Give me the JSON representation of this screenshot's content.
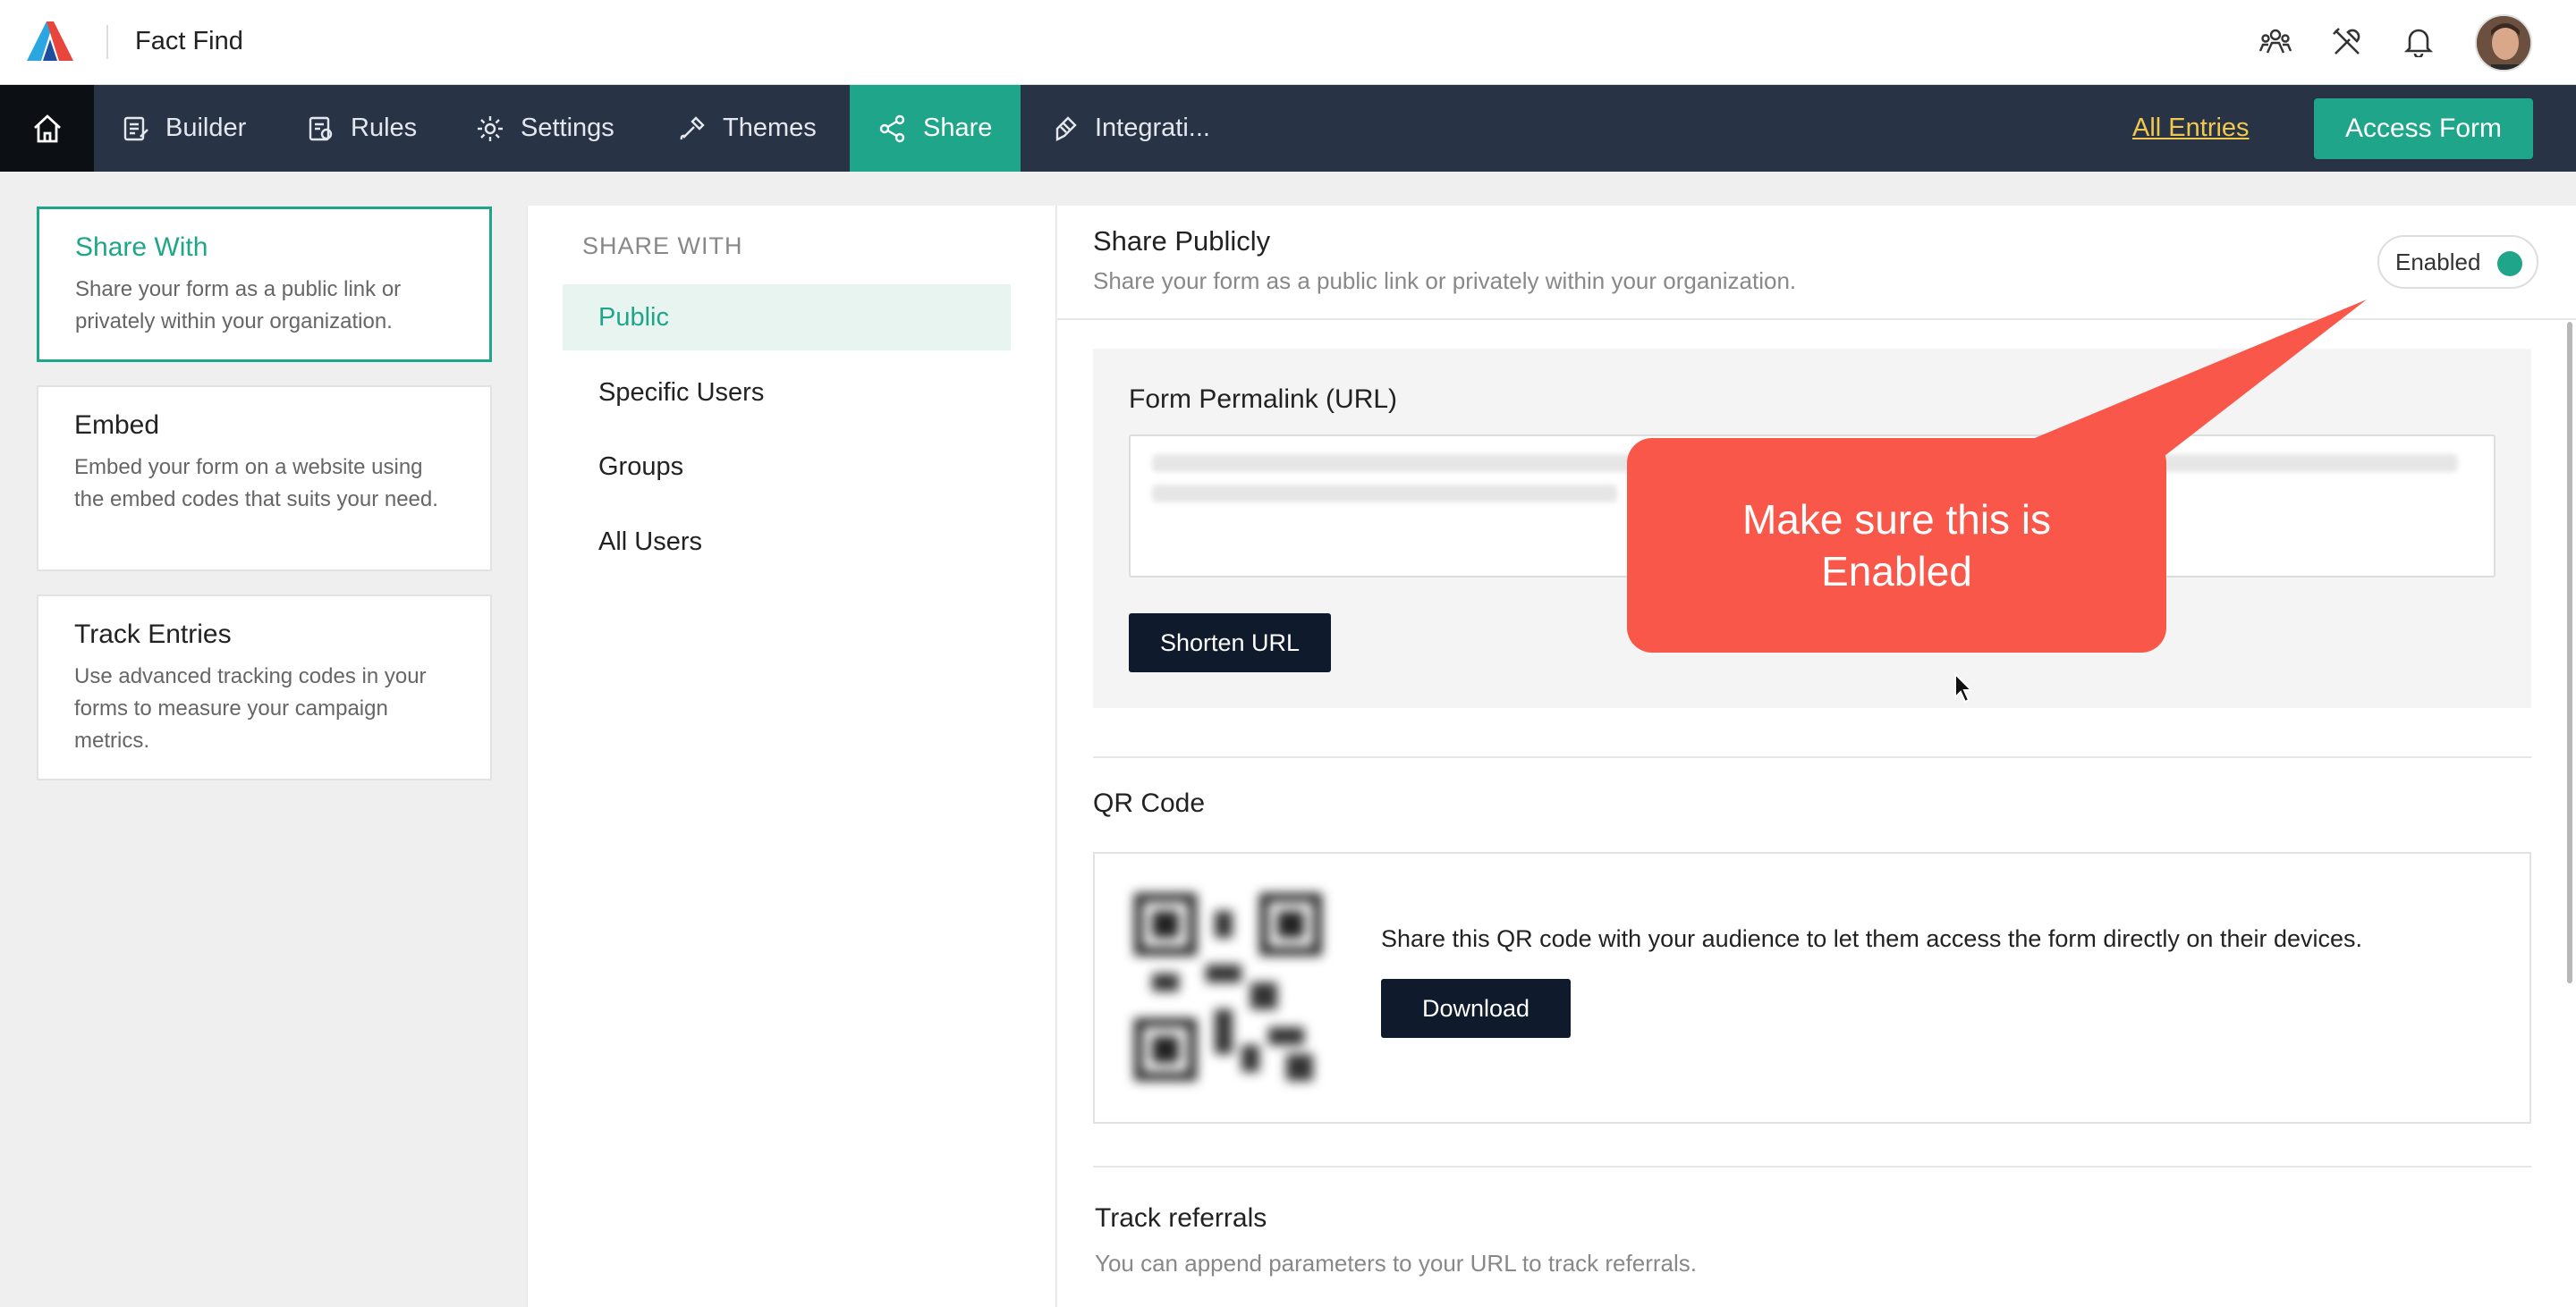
{
  "topbar": {
    "title": "Fact Find",
    "icons": [
      "team-icon",
      "tools-icon",
      "bell-icon",
      "avatar"
    ]
  },
  "navbar": {
    "home_icon": "home-icon",
    "items": [
      {
        "label": "Builder",
        "icon": "builder-icon"
      },
      {
        "label": "Rules",
        "icon": "rules-icon"
      },
      {
        "label": "Settings",
        "icon": "gear-icon"
      },
      {
        "label": "Themes",
        "icon": "brush-icon"
      },
      {
        "label": "Share",
        "icon": "share-icon",
        "active": true
      },
      {
        "label": "Integrati...",
        "icon": "plug-icon"
      }
    ],
    "all_entries": "All Entries",
    "access_form": "Access Form"
  },
  "sidebar": {
    "items": [
      {
        "title": "Share With",
        "desc": "Share your form as a public link or privately within your organization.",
        "active": true
      },
      {
        "title": "Embed",
        "desc": "Embed your form on a website using the embed codes that suits your need."
      },
      {
        "title": "Track Entries",
        "desc": "Use advanced tracking codes in your forms to measure your campaign metrics."
      }
    ]
  },
  "share_with": {
    "heading": "SHARE WITH",
    "items": [
      "Public",
      "Specific Users",
      "Groups",
      "All Users"
    ],
    "active": "Public"
  },
  "main": {
    "title": "Share Publicly",
    "subtitle": "Share your form as a public link or privately within your organization.",
    "toggle_label": "Enabled",
    "toggle_on": true,
    "permalink_label": "Form Permalink (URL)",
    "shorten_label": "Shorten URL",
    "qr_title": "QR Code",
    "qr_text": "Share this QR code with your audience to let them access the form directly on their devices.",
    "download_label": "Download",
    "track_title": "Track referrals",
    "track_sub": "You can append parameters to your URL to track referrals."
  },
  "callout": {
    "text": "Make sure this is Enabled"
  },
  "colors": {
    "accent": "#1fa589",
    "nav_bg": "#283445",
    "callout": "#f9574a",
    "link": "#f1c84c"
  }
}
